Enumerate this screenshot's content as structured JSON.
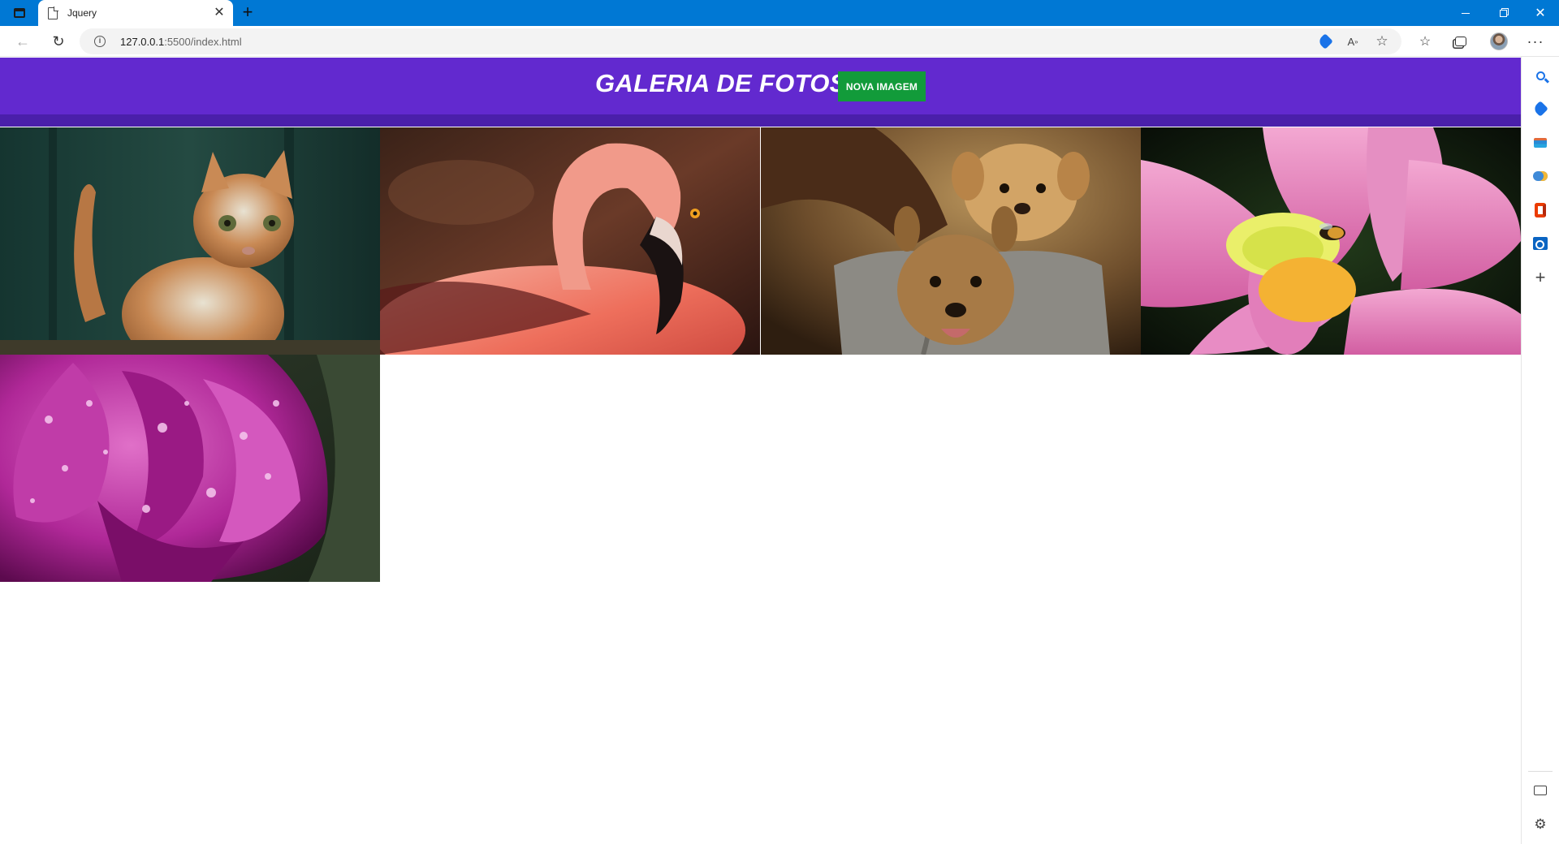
{
  "browser": {
    "tab_title": "Jquery",
    "url_host": "127.0.0.1",
    "url_path": ":5500/index.html"
  },
  "page": {
    "title": "GALERIA DE FOTOS",
    "new_image_button": "NOVA IMAGEM",
    "colors": {
      "header": "#6229cf",
      "header_stripe": "#4a1faa",
      "button": "#129b3a"
    }
  },
  "gallery": {
    "images": [
      {
        "subject": "cat"
      },
      {
        "subject": "flamingo"
      },
      {
        "subject": "puppies"
      },
      {
        "subject": "lotus-flower-with-bee"
      },
      {
        "subject": "purple-tulip-with-water-drops"
      }
    ]
  },
  "icons": {
    "browser": [
      "window-icon",
      "page-icon",
      "close-icon",
      "plus-icon",
      "back-icon",
      "reload-icon",
      "info-icon",
      "shopping-tag-icon",
      "read-aloud-icon",
      "favorite-star-icon",
      "favorites-icon",
      "collections-icon",
      "profile-avatar",
      "more-icon"
    ],
    "sidebar": [
      "search-icon",
      "shopping-icon",
      "tools-icon",
      "games-icon",
      "office-icon",
      "outlook-icon",
      "add-icon",
      "hide-sidebar-icon",
      "settings-icon"
    ]
  }
}
